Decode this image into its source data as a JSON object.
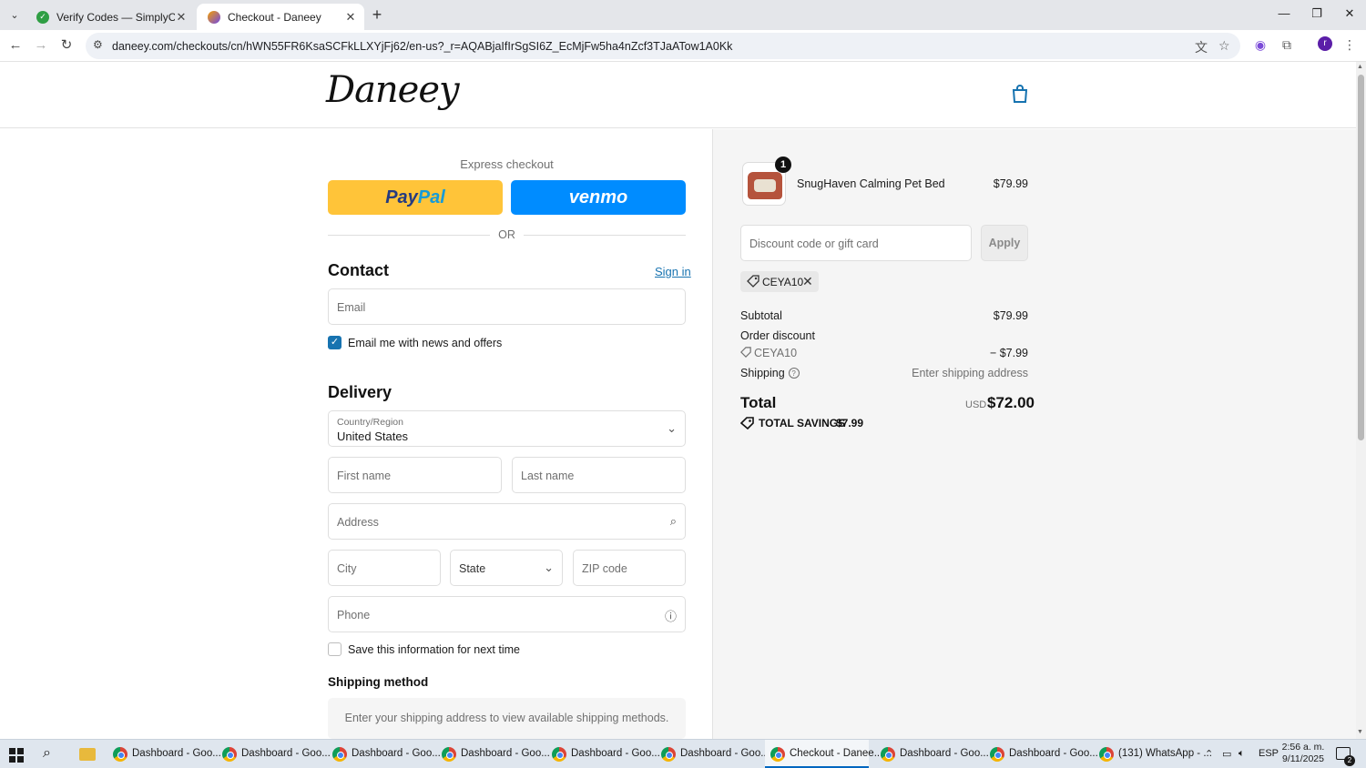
{
  "browser": {
    "tabs": [
      {
        "title": "Verify Codes — SimplyCodes",
        "active": false
      },
      {
        "title": "Checkout - Daneey",
        "active": true
      }
    ],
    "url": "daneey.com/checkouts/cn/hWN55FR6KsaSCFkLLXYjFj62/en-us?_r=AQABjaIfIrSgSI6Z_EcMjFw5ha4nZcf3TJaATow1A0Kk"
  },
  "store": {
    "logo": "Daneey"
  },
  "express": {
    "label": "Express checkout",
    "paypal_a": "Pay",
    "paypal_b": "Pal",
    "venmo": "venmo",
    "or": "OR"
  },
  "contact": {
    "title": "Contact",
    "sign_in": "Sign in",
    "email_placeholder": "Email",
    "news_label": "Email me with news and offers",
    "news_checked": true
  },
  "delivery": {
    "title": "Delivery",
    "country_label": "Country/Region",
    "country_value": "United States",
    "first_name": "First name",
    "last_name": "Last name",
    "address": "Address",
    "city": "City",
    "state": "State",
    "zip": "ZIP code",
    "phone": "Phone",
    "save_label": "Save this information for next time",
    "save_checked": false
  },
  "shipping": {
    "title": "Shipping method",
    "message": "Enter your shipping address to view available shipping methods."
  },
  "summary": {
    "item": {
      "name": "SnugHaven Calming Pet Bed",
      "price": "$79.99",
      "qty": "1"
    },
    "discount_placeholder": "Discount code or gift card",
    "apply": "Apply",
    "applied_code": "CEYA10",
    "subtotal_label": "Subtotal",
    "subtotal": "$79.99",
    "order_discount_label": "Order discount",
    "discount_code": "CEYA10",
    "discount_amount": "− $7.99",
    "shipping_label": "Shipping",
    "shipping_value": "Enter shipping address",
    "total_label": "Total",
    "currency": "USD",
    "total": "$72.00",
    "savings_label": "TOTAL SAVINGS",
    "savings": "$7.99"
  },
  "taskbar": {
    "items": [
      {
        "label": "Dashboard - Goo..."
      },
      {
        "label": "Dashboard - Goo..."
      },
      {
        "label": "Dashboard - Goo..."
      },
      {
        "label": "Dashboard - Goo..."
      },
      {
        "label": "Dashboard - Goo..."
      },
      {
        "label": "Dashboard - Goo..."
      },
      {
        "label": "Checkout - Danee..."
      },
      {
        "label": "Dashboard - Goo..."
      },
      {
        "label": "Dashboard - Goo..."
      },
      {
        "label": "(131) WhatsApp - ..."
      }
    ],
    "lang": "ESP",
    "time": "2:56 a. m.",
    "date": "9/11/2025",
    "notifications": "2"
  },
  "colors": {
    "accent": "#1773b0",
    "paypal": "#ffc439",
    "venmo": "#008cff"
  }
}
